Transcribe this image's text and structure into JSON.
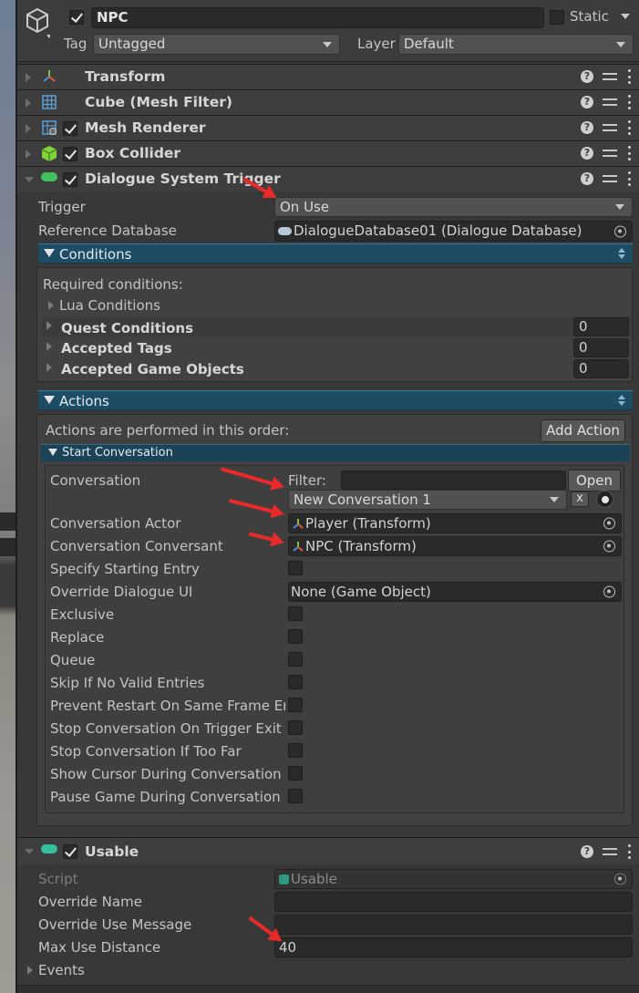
{
  "object": {
    "name": "NPC",
    "static_label": "Static",
    "tag_label": "Tag",
    "tag_value": "Untagged",
    "layer_label": "Layer",
    "layer_value": "Default"
  },
  "components": [
    {
      "title": "Transform",
      "icon": "transform-icon"
    },
    {
      "title": "Cube (Mesh Filter)",
      "icon": "mesh-filter-icon"
    },
    {
      "title": "Mesh Renderer",
      "icon": "mesh-renderer-icon"
    },
    {
      "title": "Box Collider",
      "icon": "box-collider-icon"
    },
    {
      "title": "Dialogue System Trigger",
      "icon": "trigger-icon"
    },
    {
      "title": "Usable",
      "icon": "usable-icon"
    }
  ],
  "trigger": {
    "trigger_label": "Trigger",
    "trigger_value": "On Use",
    "refdb_label": "Reference Database",
    "refdb_value": "DialogueDatabase01 (Dialogue Database)"
  },
  "conditions": {
    "section_label": "Conditions",
    "required_label": "Required conditions:",
    "lua_label": "Lua Conditions",
    "quest_label": "Quest Conditions",
    "quest_value": "0",
    "tags_label": "Accepted Tags",
    "tags_value": "0",
    "gameobjects_label": "Accepted Game Objects",
    "gameobjects_value": "0"
  },
  "actions": {
    "section_label": "Actions",
    "order_label": "Actions are performed in this order:",
    "add_action_label": "Add Action",
    "start_conversation_label": "Start Conversation",
    "conversation_label": "Conversation",
    "filter_label": "Filter:",
    "open_label": "Open",
    "conversation_value": "New Conversation 1",
    "clear_label": "x",
    "actor_label": "Conversation Actor",
    "actor_value": "Player (Transform)",
    "conversant_label": "Conversation Conversant",
    "conversant_value": "NPC (Transform)",
    "specify_entry_label": "Specify Starting Entry",
    "override_ui_label": "Override Dialogue UI",
    "override_ui_value": "None (Game Object)",
    "exclusive_label": "Exclusive",
    "replace_label": "Replace",
    "queue_label": "Queue",
    "skip_label": "Skip If No Valid Entries",
    "prevent_label": "Prevent Restart On Same Frame Enc",
    "stop_exit_label": "Stop Conversation On Trigger Exit",
    "stop_far_label": "Stop Conversation If Too Far",
    "show_cursor_label": "Show Cursor During Conversation",
    "pause_label": "Pause Game During Conversation"
  },
  "usable": {
    "script_label": "Script",
    "script_value": "Usable",
    "override_name_label": "Override Name",
    "override_msg_label": "Override Use Message",
    "max_distance_label": "Max Use Distance",
    "max_distance_value": "40",
    "events_label": "Events"
  },
  "colors": {
    "annotation_arrow": "#ea2a2a",
    "section_bar": "#1d4d64"
  }
}
